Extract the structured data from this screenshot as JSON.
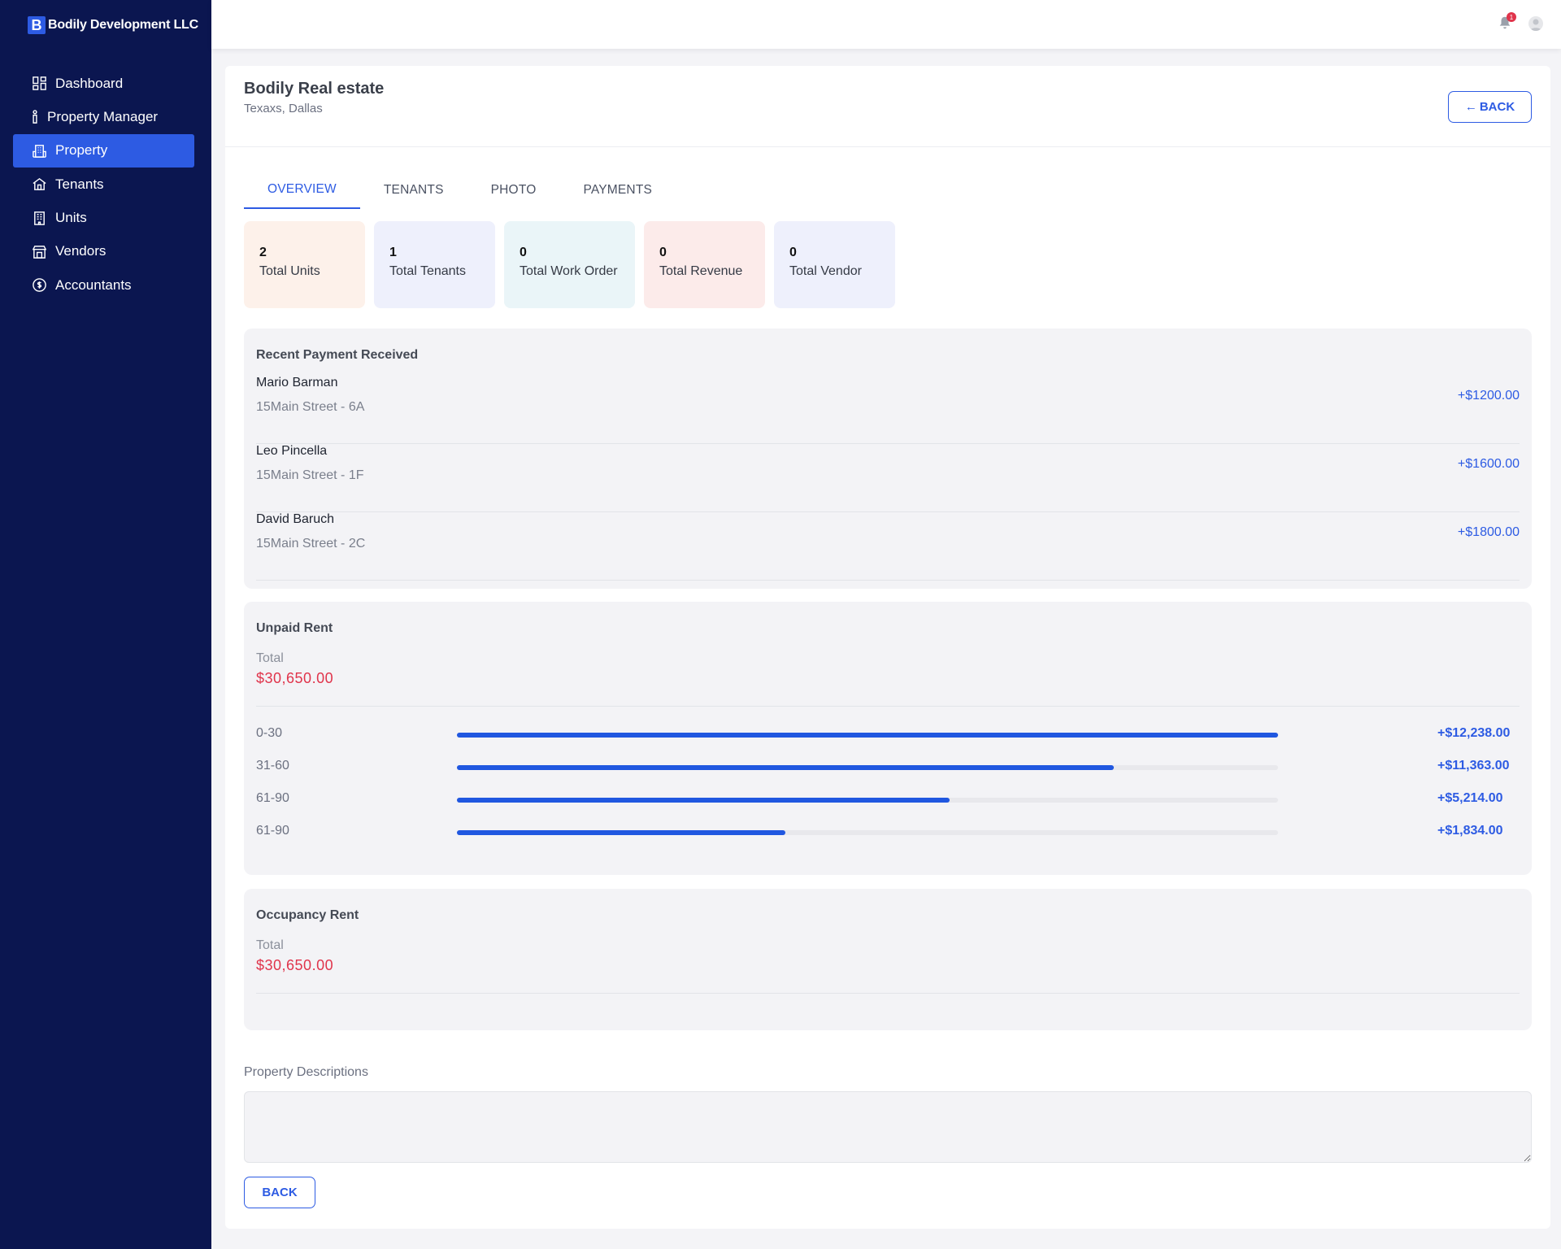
{
  "brand": {
    "logo_letter": "B",
    "name": "Bodily Development LLC"
  },
  "sidebar": {
    "items": [
      {
        "label": "Dashboard",
        "icon": "dashboard-icon"
      },
      {
        "label": "Property Manager",
        "icon": "person-icon"
      },
      {
        "label": "Property",
        "icon": "building-icon",
        "active": true
      },
      {
        "label": "Tenants",
        "icon": "house-icon"
      },
      {
        "label": "Units",
        "icon": "office-icon"
      },
      {
        "label": "Vendors",
        "icon": "store-icon"
      },
      {
        "label": "Accountants",
        "icon": "dollar-circle-icon"
      }
    ]
  },
  "topbar": {
    "notification_count": "1",
    "icons": [
      "bell-icon",
      "user-avatar-icon"
    ]
  },
  "header": {
    "title": "Bodily Real estate",
    "subtitle": "Texaxs, Dallas",
    "back_label": "BACK"
  },
  "tabs": [
    {
      "label": "OVERVIEW",
      "active": true
    },
    {
      "label": "TENANTS"
    },
    {
      "label": "PHOTO"
    },
    {
      "label": "PAYMENTS"
    }
  ],
  "stats": [
    {
      "value": "2",
      "label": "Total Units",
      "bg": "#fdf1ea"
    },
    {
      "value": "1",
      "label": "Total Tenants",
      "bg": "#eef0fc"
    },
    {
      "value": "0",
      "label": "Total Work Order",
      "bg": "#eaf5f8"
    },
    {
      "value": "0",
      "label": "Total Revenue",
      "bg": "#fcebea"
    },
    {
      "value": "0",
      "label": "Total Vendor",
      "bg": "#eef0fc"
    }
  ],
  "recent_payments": {
    "title": "Recent Payment Received",
    "rows": [
      {
        "name": "Mario Barman",
        "address": "15Main Street - 6A",
        "amount": "+$1200.00"
      },
      {
        "name": "Leo Pincella",
        "address": "15Main Street - 1F",
        "amount": "+$1600.00"
      },
      {
        "name": "David Baruch",
        "address": "15Main Street - 2C",
        "amount": "+$1800.00"
      }
    ]
  },
  "unpaid_rent": {
    "title": "Unpaid Rent",
    "total_label": "Total",
    "total_value": "$30,650.00",
    "buckets": [
      {
        "label": "0-30",
        "amount": "+$12,238.00",
        "fill_fraction": 1.0
      },
      {
        "label": "31-60",
        "amount": "+$11,363.00",
        "fill_fraction": 0.8
      },
      {
        "label": "61-90",
        "amount": "+$5,214.00",
        "fill_fraction": 0.6
      },
      {
        "label": "61-90",
        "amount": "+$1,834.00",
        "fill_fraction": 0.4
      }
    ]
  },
  "occupancy_rent": {
    "title": "Occupancy Rent",
    "total_label": "Total",
    "total_value": "$30,650.00"
  },
  "description": {
    "label": "Property Descriptions",
    "value": ""
  },
  "footer": {
    "back_label": "BACK"
  },
  "colors": {
    "sidebar_bg": "#0b1650",
    "accent": "#2d5be3",
    "danger": "#e0344b"
  }
}
